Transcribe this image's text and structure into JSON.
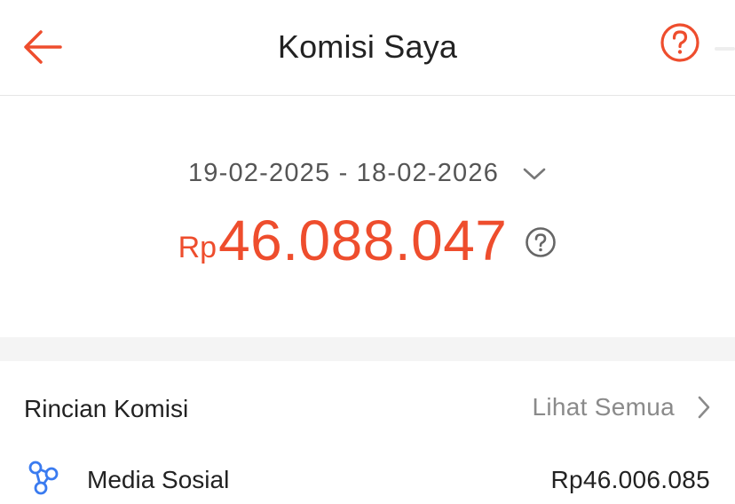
{
  "header": {
    "title": "Komisi Saya",
    "back_icon": "arrow-left-icon",
    "help_icon": "question-circle-icon"
  },
  "summary": {
    "date_range": "19-02-2025 - 18-02-2026",
    "dropdown_icon": "chevron-down-icon",
    "currency": "Rp",
    "amount": "46.088.047",
    "info_icon": "question-circle-icon"
  },
  "detail": {
    "title": "Rincian Komisi",
    "see_all_label": "Lihat Semua",
    "see_all_icon": "chevron-right-icon",
    "items": [
      {
        "icon": "share-nodes-icon",
        "label": "Media Sosial",
        "value": "Rp46.006.085"
      }
    ]
  },
  "colors": {
    "accent": "#ee4d2d",
    "icon_blue": "#3a7bf0",
    "muted_text": "#8a8a8a",
    "band": "#f4f4f4"
  }
}
